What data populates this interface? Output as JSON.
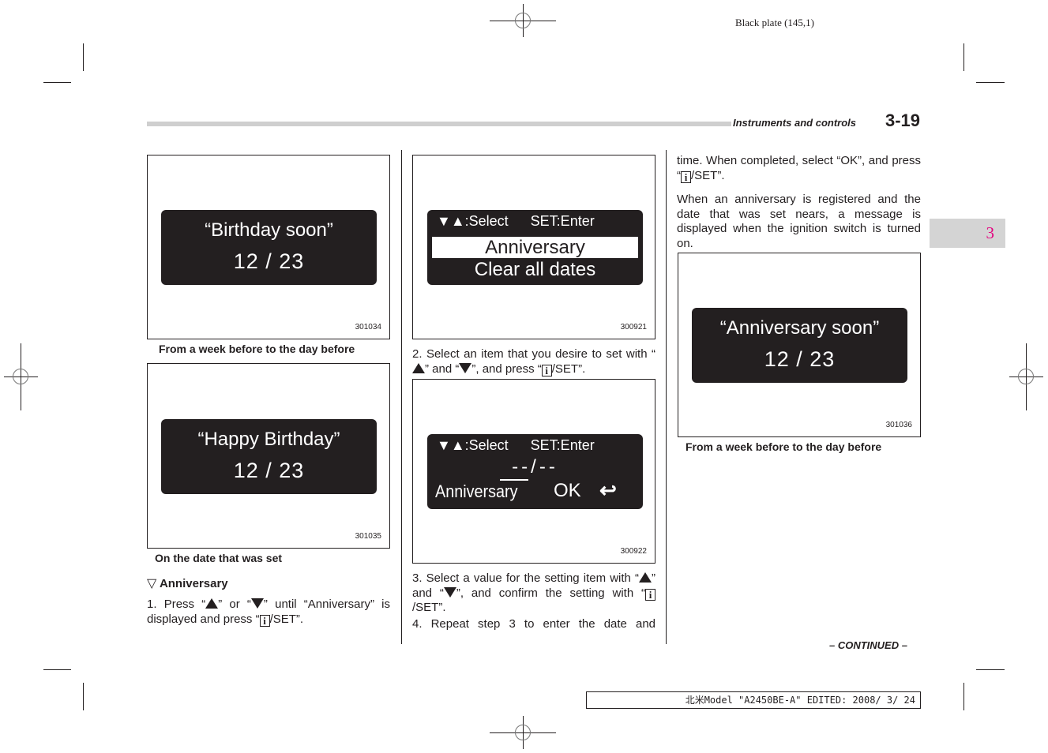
{
  "print": {
    "plate": "Black plate (145,1)",
    "footer": "北米Model \"A2450BE-A\" EDITED: 2008/ 3/ 24"
  },
  "header": {
    "section": "Instruments and controls",
    "page_number": "3-19",
    "chapter_tab": "3"
  },
  "figures": {
    "f1": {
      "id": "301034",
      "line1": "“Birthday soon”",
      "line2": "12 / 23",
      "caption": "From a week before to the day before"
    },
    "f2": {
      "id": "301035",
      "line1": "“Happy Birthday”",
      "line2": "12 / 23",
      "caption": "On the date that was set"
    },
    "f3": {
      "id": "300921",
      "head_select": "▼▲:Select",
      "head_enter": "SET:Enter",
      "selected": "Anniversary",
      "item": "Clear all dates"
    },
    "f4": {
      "id": "300922",
      "head_select": "▼▲:Select",
      "head_enter": "SET:Enter",
      "date": "--/--",
      "label": "Anniversary",
      "ok": "OK",
      "back": "↩"
    },
    "f5": {
      "id": "301036",
      "line1": "“Anniversary soon”",
      "line2": "12 / 23",
      "caption": "From a week before to the day before"
    }
  },
  "content": {
    "subheading_marker": "▽",
    "subheading": "Anniversary",
    "step1": {
      "a": "1.  Press “",
      "b": "” or “",
      "c": "” until “Anniversary” is displayed and press “",
      "d": "/SET”."
    },
    "step2": {
      "a": "2.  Select an item that you desire to set with “",
      "b": "” and “",
      "c": "”, and press “",
      "d": "/SET”."
    },
    "step3": {
      "a": "3.  Select a value for the setting item with “",
      "b": "” and “",
      "c": "”, and confirm the setting with “",
      "d": "/SET”."
    },
    "step4": "4.  Repeat step 3 to enter the date and",
    "cont_a": "time. When completed, select “OK”, and press “",
    "cont_b": "/SET”.",
    "para": "When an anniversary is registered and the date that was set nears, a message is displayed when the ignition switch is turned on.",
    "info_glyph": "i",
    "continued": "– CONTINUED –"
  }
}
